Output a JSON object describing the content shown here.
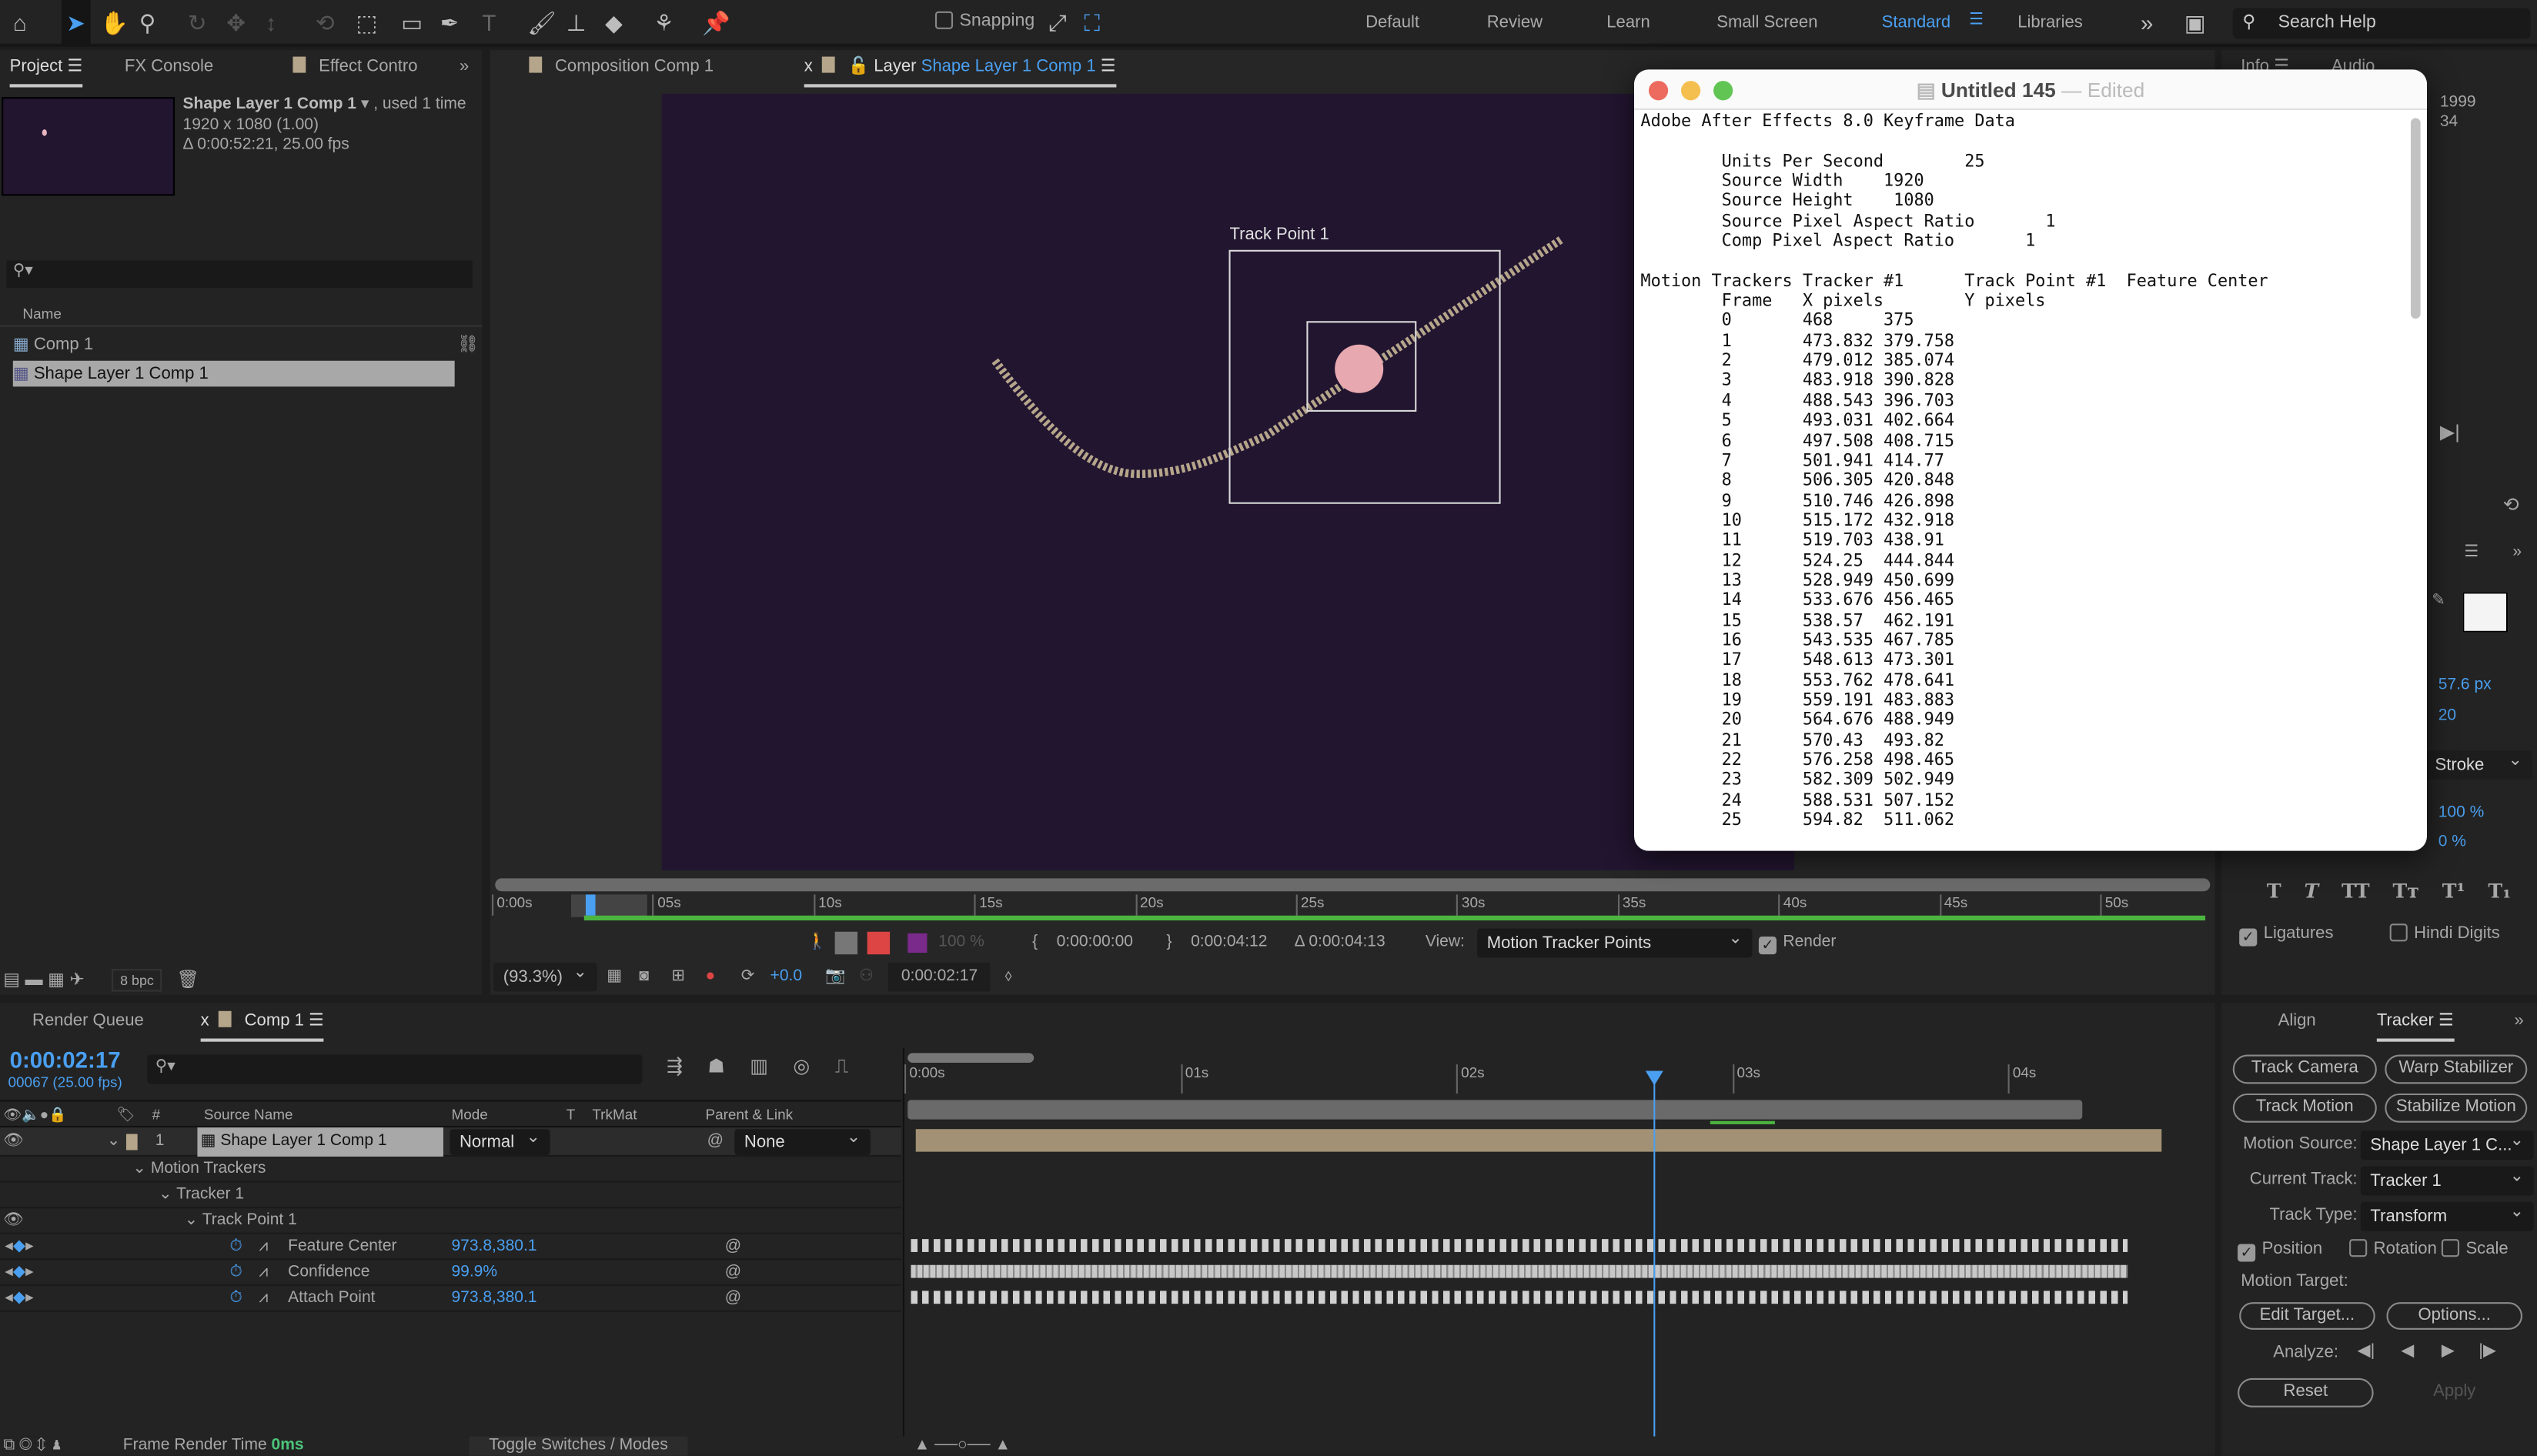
{
  "toolbar": {
    "snapping": "Snapping",
    "workspaces": [
      "Default",
      "Review",
      "Learn",
      "Small Screen",
      "Standard",
      "Libraries"
    ],
    "active_workspace": "Standard",
    "search_placeholder": "Search Help"
  },
  "project": {
    "tabs": [
      "Project",
      "FX Console",
      "Effect Contro"
    ],
    "item_name": "Shape Layer 1 Comp 1",
    "used": ", used 1 time",
    "dims": "1920 x 1080 (1.00)",
    "duration": "Δ 0:00:52:21, 25.00 fps",
    "col_name": "Name",
    "items": [
      "Comp 1",
      "Shape Layer 1 Comp 1"
    ],
    "bpc": "8 bpc"
  },
  "viewer": {
    "tabs": {
      "composition": "Composition Comp 1",
      "layer_prefix": "Layer",
      "layer_name": "Shape Layer 1 Comp 1"
    },
    "track_point_label": "Track Point 1",
    "ruler": [
      "0:00s",
      "05s",
      "10s",
      "15s",
      "20s",
      "25s",
      "30s",
      "35s",
      "40s",
      "45s",
      "50s"
    ],
    "zoom_pct": "100 %",
    "in": "0:00:00:00",
    "out": "0:00:04:12",
    "delta": "Δ 0:00:04:13",
    "view_label": "View:",
    "view_value": "Motion Tracker Points",
    "render": "Render",
    "magnification": "(93.3%)",
    "exposure": "+0.0",
    "time": "0:00:02:17"
  },
  "textedit": {
    "title": "Untitled 145",
    "edited": "Edited",
    "header": "Adobe After Effects 8.0 Keyframe Data",
    "meta": [
      [
        "Units Per Second",
        "25"
      ],
      [
        "Source Width",
        "1920"
      ],
      [
        "Source Height",
        "1080"
      ],
      [
        "Source Pixel Aspect Ratio",
        "1"
      ],
      [
        "Comp Pixel Aspect Ratio",
        "1"
      ]
    ],
    "section": "Motion Trackers Tracker #1      Track Point #1  Feature Center",
    "columns": "Frame   X pixels        Y pixels",
    "rows": [
      [
        "0",
        "468",
        "375"
      ],
      [
        "1",
        "473.832",
        "379.758"
      ],
      [
        "2",
        "479.012",
        "385.074"
      ],
      [
        "3",
        "483.918",
        "390.828"
      ],
      [
        "4",
        "488.543",
        "396.703"
      ],
      [
        "5",
        "493.031",
        "402.664"
      ],
      [
        "6",
        "497.508",
        "408.715"
      ],
      [
        "7",
        "501.941",
        "414.77"
      ],
      [
        "8",
        "506.305",
        "420.848"
      ],
      [
        "9",
        "510.746",
        "426.898"
      ],
      [
        "10",
        "515.172",
        "432.918"
      ],
      [
        "11",
        "519.703",
        "438.91"
      ],
      [
        "12",
        "524.25",
        "444.844"
      ],
      [
        "13",
        "528.949",
        "450.699"
      ],
      [
        "14",
        "533.676",
        "456.465"
      ],
      [
        "15",
        "538.57",
        "462.191"
      ],
      [
        "16",
        "543.535",
        "467.785"
      ],
      [
        "17",
        "548.613",
        "473.301"
      ],
      [
        "18",
        "553.762",
        "478.641"
      ],
      [
        "19",
        "559.191",
        "483.883"
      ],
      [
        "20",
        "564.676",
        "488.949"
      ],
      [
        "21",
        "570.43",
        "493.82"
      ],
      [
        "22",
        "576.258",
        "498.465"
      ],
      [
        "23",
        "582.309",
        "502.949"
      ],
      [
        "24",
        "588.531",
        "507.152"
      ],
      [
        "25",
        "594.82",
        "511.062"
      ]
    ]
  },
  "info": {
    "tabs": [
      "Info",
      "Audio"
    ],
    "v1": "1999",
    "v2": "34"
  },
  "character": {
    "size": "57.6 px",
    "leading": "20",
    "stroke": "Stroke",
    "scale_v": "100 %",
    "baseline": "0 %",
    "ligatures": "Ligatures",
    "hindi": "Hindi Digits"
  },
  "timeline": {
    "tabs": [
      "Render Queue",
      "Comp 1"
    ],
    "time": "0:00:02:17",
    "frames": "00067 (25.00 fps)",
    "cols": {
      "num": "#",
      "source": "Source Name",
      "mode": "Mode",
      "t": "T",
      "trkmat": "TrkMat",
      "parent": "Parent & Link"
    },
    "layer": {
      "num": "1",
      "name": "Shape Layer 1 Comp 1",
      "mode": "Normal",
      "parent": "None"
    },
    "groups": [
      "Motion Trackers",
      "Tracker 1",
      "Track Point 1"
    ],
    "props": [
      {
        "name": "Feature Center",
        "value": "973.8,380.1"
      },
      {
        "name": "Confidence",
        "value": "99.9%"
      },
      {
        "name": "Attach Point",
        "value": "973.8,380.1"
      }
    ],
    "ruler": [
      "0:00s",
      "01s",
      "02s",
      "03s",
      "04s"
    ],
    "status_label": "Frame Render Time",
    "status_value": "0ms",
    "toggle": "Toggle Switches / Modes"
  },
  "tracker": {
    "tabs": [
      "Align",
      "Tracker"
    ],
    "track_camera": "Track Camera",
    "warp": "Warp Stabilizer",
    "track_motion": "Track Motion",
    "stabilize": "Stabilize Motion",
    "motion_source_label": "Motion Source:",
    "motion_source": "Shape Layer 1 C...",
    "current_track_label": "Current Track:",
    "current_track": "Tracker 1",
    "track_type_label": "Track Type:",
    "track_type": "Transform",
    "position": "Position",
    "rotation": "Rotation",
    "scale": "Scale",
    "position_checked": true,
    "motion_target": "Motion Target:",
    "edit_target": "Edit Target...",
    "options": "Options...",
    "analyze": "Analyze:",
    "reset": "Reset",
    "apply": "Apply"
  },
  "colors": {
    "accent": "#4a9ff0",
    "comp_bg": "#221530",
    "label_tan": "#b5a58a",
    "work_area": "#4cb53f"
  }
}
